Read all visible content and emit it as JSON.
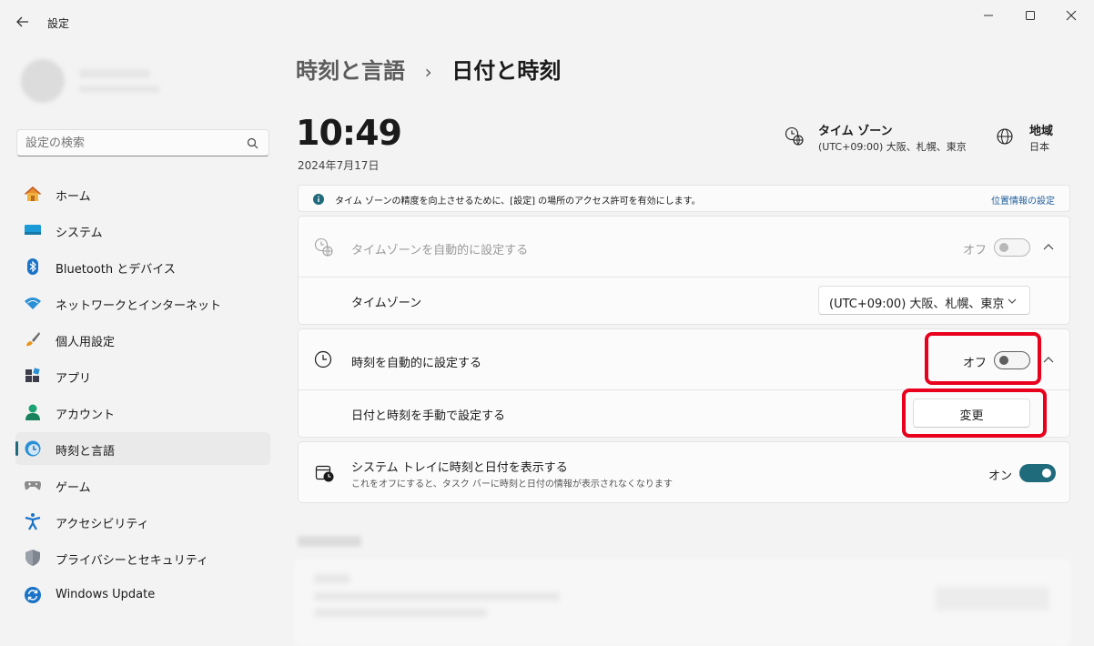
{
  "window": {
    "title": "設定",
    "controls": [
      "minimize",
      "maximize",
      "close"
    ]
  },
  "search": {
    "placeholder": "設定の検索"
  },
  "nav": {
    "items": [
      {
        "label": "ホーム",
        "icon": "home-icon"
      },
      {
        "label": "システム",
        "icon": "system-icon"
      },
      {
        "label": "Bluetooth とデバイス",
        "icon": "bluetooth-icon"
      },
      {
        "label": "ネットワークとインターネット",
        "icon": "wifi-icon"
      },
      {
        "label": "個人用設定",
        "icon": "brush-icon"
      },
      {
        "label": "アプリ",
        "icon": "apps-icon"
      },
      {
        "label": "アカウント",
        "icon": "account-icon"
      },
      {
        "label": "時刻と言語",
        "icon": "time-language-icon",
        "selected": true
      },
      {
        "label": "ゲーム",
        "icon": "gamepad-icon"
      },
      {
        "label": "アクセシビリティ",
        "icon": "accessibility-icon"
      },
      {
        "label": "プライバシーとセキュリティ",
        "icon": "shield-icon"
      },
      {
        "label": "Windows Update",
        "icon": "windows-update-icon"
      }
    ]
  },
  "breadcrumb": {
    "parent": "時刻と言語",
    "separator": "›",
    "current": "日付と時刻"
  },
  "clock": {
    "time": "10:49",
    "date": "2024年7月17日"
  },
  "timezone_summary": {
    "title": "タイム ゾーン",
    "value": "(UTC+09:00) 大阪、札幌、東京"
  },
  "region_summary": {
    "title": "地域",
    "value": "日本"
  },
  "info_bar": {
    "message": "タイム ゾーンの精度を向上させるために、[設定] の場所のアクセス許可を有効にします。",
    "link": "位置情報の設定"
  },
  "auto_timezone": {
    "label": "タイムゾーンを自動的に設定する",
    "state_label": "オフ",
    "enabled": false,
    "disabled": true
  },
  "timezone": {
    "label": "タイムゾーン",
    "selected": "(UTC+09:00) 大阪、札幌、東京"
  },
  "auto_time": {
    "label": "時刻を自動的に設定する",
    "state_label": "オフ",
    "enabled": false
  },
  "manual_time": {
    "label": "日付と時刻を手動で設定する",
    "button": "変更"
  },
  "tray_clock": {
    "label": "システム トレイに時刻と日付を表示する",
    "description": "これをオフにすると、タスク バーに時刻と日付の情報が表示されなくなります",
    "state_label": "オン",
    "enabled": true
  },
  "colors": {
    "accent": "#1f6b7c",
    "highlight": "#e8001c",
    "background": "#f3f3f3",
    "card": "#fbfbfb"
  }
}
